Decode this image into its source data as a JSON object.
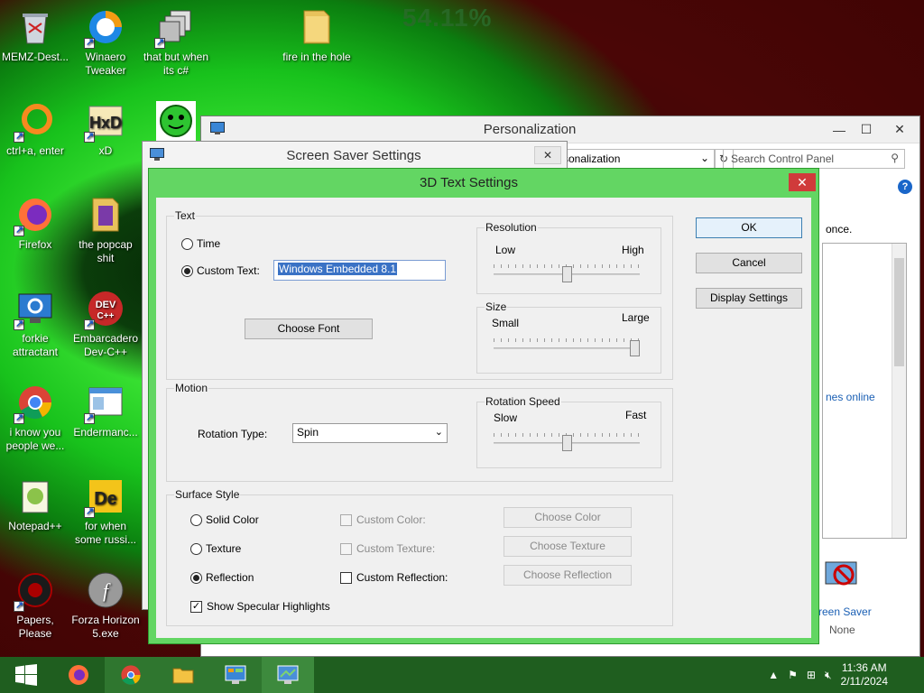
{
  "desktop": {
    "percentage": "54.11%",
    "icons": [
      {
        "label": "MEMZ-Dest...",
        "icon": "recycle-bin-icon"
      },
      {
        "label": "Winaero Tweaker",
        "icon": "winaero-icon"
      },
      {
        "label": "that but when its c#",
        "icon": "windows-stack-icon"
      },
      {
        "label": "fire in the hole",
        "icon": "folder-icon"
      },
      {
        "label": "ctrl+a, enter",
        "icon": "ring-icon"
      },
      {
        "label": "xD",
        "icon": "hxd-icon"
      },
      {
        "label": "Firefox",
        "icon": "firefox-icon"
      },
      {
        "label": "the popcap shit",
        "icon": "folder-icon"
      },
      {
        "label": "forkie attractant",
        "icon": "monitor-gear-icon"
      },
      {
        "label": "Embarcadero Dev-C++",
        "icon": "devcpp-icon"
      },
      {
        "label": "i know you people we...",
        "icon": "chrome-icon"
      },
      {
        "label": "Endermanc...",
        "icon": "window-icon"
      },
      {
        "label": "Notepad++",
        "icon": "notepadpp-icon"
      },
      {
        "label": "for when some russi...",
        "icon": "de-icon"
      },
      {
        "label": "Papers, Please",
        "icon": "papers-icon"
      },
      {
        "label": "Forza Horizon 5.exe",
        "icon": "flash-icon"
      }
    ]
  },
  "personalization": {
    "title": "Personalization",
    "address": "rsonalization",
    "search_placeholder": "Search Control Panel",
    "once_text": "once.",
    "themes_link": "nes online",
    "screen_saver_label": "reen Saver",
    "screen_saver_value": "None"
  },
  "screen_saver_window": {
    "title": "Screen Saver Settings"
  },
  "dialog": {
    "title": "3D Text Settings",
    "text_group": {
      "caption": "Text",
      "time_label": "Time",
      "custom_text_label": "Custom Text:",
      "custom_text_value": "Windows Embedded 8.1",
      "choose_font": "Choose Font"
    },
    "resolution": {
      "caption": "Resolution",
      "low": "Low",
      "high": "High",
      "value": 0.5
    },
    "size": {
      "caption": "Size",
      "small": "Small",
      "large": "Large",
      "value": 1.0
    },
    "motion": {
      "caption": "Motion",
      "rotation_type_label": "Rotation Type:",
      "rotation_type_value": "Spin"
    },
    "rotation_speed": {
      "caption": "Rotation Speed",
      "slow": "Slow",
      "fast": "Fast",
      "value": 0.5
    },
    "surface": {
      "caption": "Surface Style",
      "solid_color": "Solid Color",
      "texture": "Texture",
      "reflection": "Reflection",
      "custom_color": "Custom Color:",
      "custom_texture": "Custom Texture:",
      "custom_reflection": "Custom Reflection:",
      "choose_color": "Choose Color",
      "choose_texture": "Choose Texture",
      "choose_reflection": "Choose Reflection",
      "specular": "Show Specular Highlights"
    },
    "buttons": {
      "ok": "OK",
      "cancel": "Cancel",
      "display_settings": "Display Settings"
    }
  },
  "taskbar": {
    "time": "11:36 AM",
    "date": "2/11/2024"
  }
}
